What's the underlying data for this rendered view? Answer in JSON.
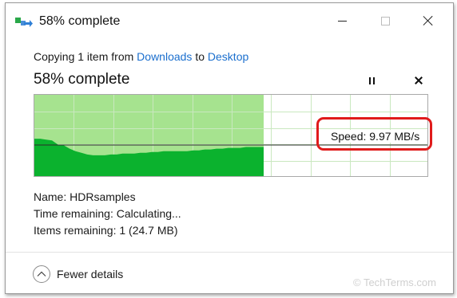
{
  "window": {
    "title": "58% complete",
    "icon": "file-copy-icon"
  },
  "dialog": {
    "copy_prefix": "Copying 1 item from ",
    "source": "Downloads",
    "copy_middle": " to ",
    "destination": "Desktop",
    "heading": "58% complete",
    "progress_percent": 58,
    "speed_label": "Speed: 9.97 MB/s",
    "details": {
      "name_label": "Name:",
      "name_value": "HDRsamples",
      "time_label": "Time remaining:",
      "time_value": "Calculating...",
      "items_label": "Items remaining:",
      "items_value": "1 (24.7 MB)"
    },
    "fewer_details": "Fewer details"
  },
  "watermark": "© TechTerms.com",
  "colors": {
    "progress_fill": "#a6e38f",
    "speed_area": "#0bb22e",
    "grid_line": "#c9e8bf",
    "link": "#1b6fce",
    "callout": "#e01b1b"
  },
  "icons": [
    "minimize-icon",
    "maximize-icon",
    "close-icon",
    "pause-icon",
    "cancel-icon",
    "chevron-up-icon"
  ]
}
